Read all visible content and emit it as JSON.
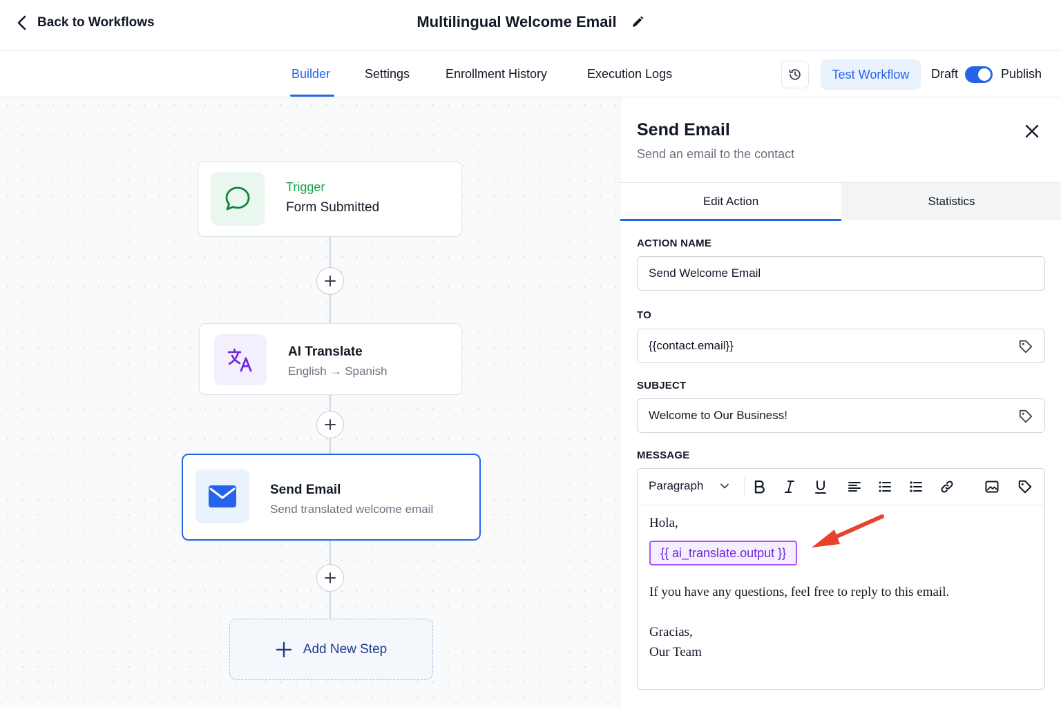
{
  "header": {
    "back_label": "Back to Workflows",
    "workflow_title": "Multilingual Welcome Email"
  },
  "nav": {
    "tabs": [
      {
        "label": "Builder",
        "active": true
      },
      {
        "label": "Settings",
        "active": false
      },
      {
        "label": "Enrollment History",
        "active": false
      },
      {
        "label": "Execution Logs",
        "active": false
      }
    ],
    "test_label": "Test Workflow",
    "draft_label": "Draft",
    "publish_label": "Publish",
    "publish_toggle_on": true
  },
  "canvas": {
    "nodes": [
      {
        "type": "trigger",
        "title": "Trigger",
        "subtitle": "Form Submitted",
        "icon": "chat-bubble-icon",
        "accent": "#16a34a"
      },
      {
        "type": "action",
        "title": "AI Translate",
        "subtitle": "English → Spanish",
        "icon": "translate-icon",
        "accent": "#7c3aed"
      },
      {
        "type": "action",
        "title": "Send Email",
        "subtitle": "Send translated welcome email",
        "icon": "mail-icon",
        "accent": "#2563eb",
        "selected": true
      }
    ],
    "add_step_label": "Add New Step"
  },
  "panel": {
    "title": "Send Email",
    "subtitle": "Send an email to the contact",
    "tabs": [
      "Edit Action",
      "Statistics"
    ],
    "fields": {
      "action_name": {
        "label": "ACTION NAME",
        "value": "Send Welcome Email"
      },
      "to": {
        "label": "TO",
        "value": "{{contact.email}}"
      },
      "subject": {
        "label": "SUBJECT",
        "value": "Welcome to Our Business!"
      },
      "message": {
        "label": "MESSAGE"
      }
    },
    "editor": {
      "format": "Paragraph",
      "greeting": "Hola,",
      "variable": "{{ ai_translate.output }}",
      "line1": "If you have any questions, feel free to reply to this email.",
      "signoff1": "Gracias,",
      "signoff2": "Our Team"
    }
  },
  "colors": {
    "accent": "#2563eb",
    "variable_border": "#a855f7",
    "annotation_arrow": "#e8432c"
  }
}
